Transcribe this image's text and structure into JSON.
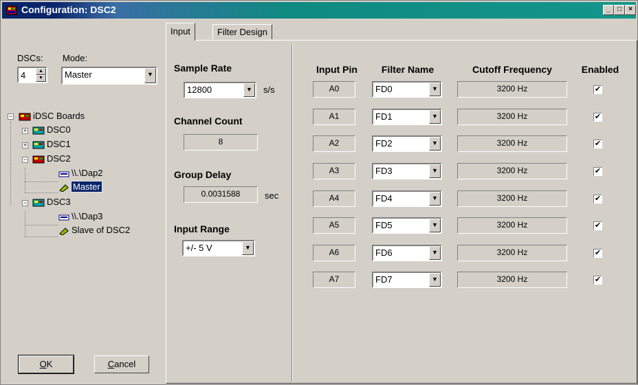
{
  "window": {
    "title": "Configuration: DSC2"
  },
  "left": {
    "dscs_label": "DSCs:",
    "dscs_value": "4",
    "mode_label": "Mode:",
    "mode_value": "Master",
    "tree": {
      "root": "iDSC Boards",
      "dsc0": "DSC0",
      "dsc1": "DSC1",
      "dsc2": "DSC2",
      "dsc2_dap": "\\\\.\\Dap2",
      "dsc2_mode": "Master",
      "dsc3": "DSC3",
      "dsc3_dap": "\\\\.\\Dap3",
      "dsc3_mode": "Slave of DSC2"
    },
    "ok_accel": "O",
    "ok_rest": "K",
    "cancel_accel": "C",
    "cancel_rest": "ancel"
  },
  "tabs": [
    "Input",
    "Filter Design"
  ],
  "settings": {
    "sample_rate_label": "Sample Rate",
    "sample_rate_value": "12800",
    "sample_rate_unit": "s/s",
    "channel_count_label": "Channel Count",
    "channel_count_value": "8",
    "group_delay_label": "Group Delay",
    "group_delay_value": "0.0031588",
    "group_delay_unit": "sec",
    "input_range_label": "Input Range",
    "input_range_value": "+/- 5 V"
  },
  "channels": {
    "headers": {
      "pin": "Input Pin",
      "filter": "Filter Name",
      "cutoff": "Cutoff Frequency",
      "enabled": "Enabled"
    },
    "rows": [
      {
        "pin": "A0",
        "filter": "FD0",
        "cutoff": "3200 Hz",
        "enabled": true
      },
      {
        "pin": "A1",
        "filter": "FD1",
        "cutoff": "3200 Hz",
        "enabled": true
      },
      {
        "pin": "A2",
        "filter": "FD2",
        "cutoff": "3200 Hz",
        "enabled": true
      },
      {
        "pin": "A3",
        "filter": "FD3",
        "cutoff": "3200 Hz",
        "enabled": true
      },
      {
        "pin": "A4",
        "filter": "FD4",
        "cutoff": "3200 Hz",
        "enabled": true
      },
      {
        "pin": "A5",
        "filter": "FD5",
        "cutoff": "3200 Hz",
        "enabled": true
      },
      {
        "pin": "A6",
        "filter": "FD6",
        "cutoff": "3200 Hz",
        "enabled": true
      },
      {
        "pin": "A7",
        "filter": "FD7",
        "cutoff": "3200 Hz",
        "enabled": true
      }
    ]
  },
  "colors": {
    "face": "#d4d0c8",
    "title_start": "#0a246a",
    "title_end": "#14968a",
    "selection": "#0a246a"
  }
}
